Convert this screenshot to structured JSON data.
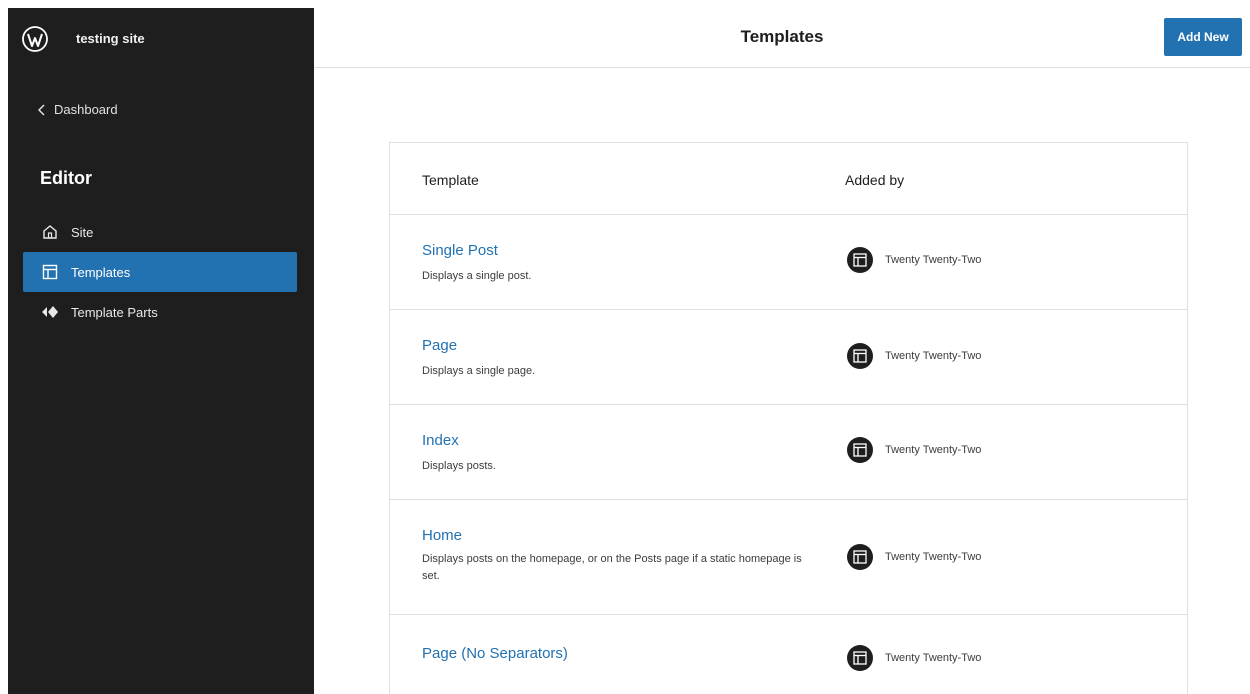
{
  "site": {
    "name": "testing site",
    "logo_icon": "wordpress-logo-icon"
  },
  "sidebar": {
    "back_label": "Dashboard",
    "heading": "Editor",
    "items": [
      {
        "label": "Site",
        "icon": "home-icon",
        "active": false
      },
      {
        "label": "Templates",
        "icon": "layout-icon",
        "active": true
      },
      {
        "label": "Template Parts",
        "icon": "symbol-filled-icon",
        "active": false
      }
    ]
  },
  "header": {
    "title": "Templates",
    "add_new_label": "Add New"
  },
  "table": {
    "columns": [
      "Template",
      "Added by"
    ],
    "rows": [
      {
        "title": "Single Post",
        "description": "Displays a single post.",
        "author": "Twenty Twenty-Two"
      },
      {
        "title": "Page",
        "description": "Displays a single page.",
        "author": "Twenty Twenty-Two"
      },
      {
        "title": "Index",
        "description": "Displays posts.",
        "author": "Twenty Twenty-Two"
      },
      {
        "title": "Home",
        "description": "Displays posts on the homepage, or on the Posts page if a static homepage is set.",
        "author": "Twenty Twenty-Two"
      },
      {
        "title": "Page (No Separators)",
        "description": "",
        "author": "Twenty Twenty-Two"
      }
    ]
  },
  "colors": {
    "accent": "#2271b1",
    "sidebar_bg": "#1e1e1e"
  }
}
